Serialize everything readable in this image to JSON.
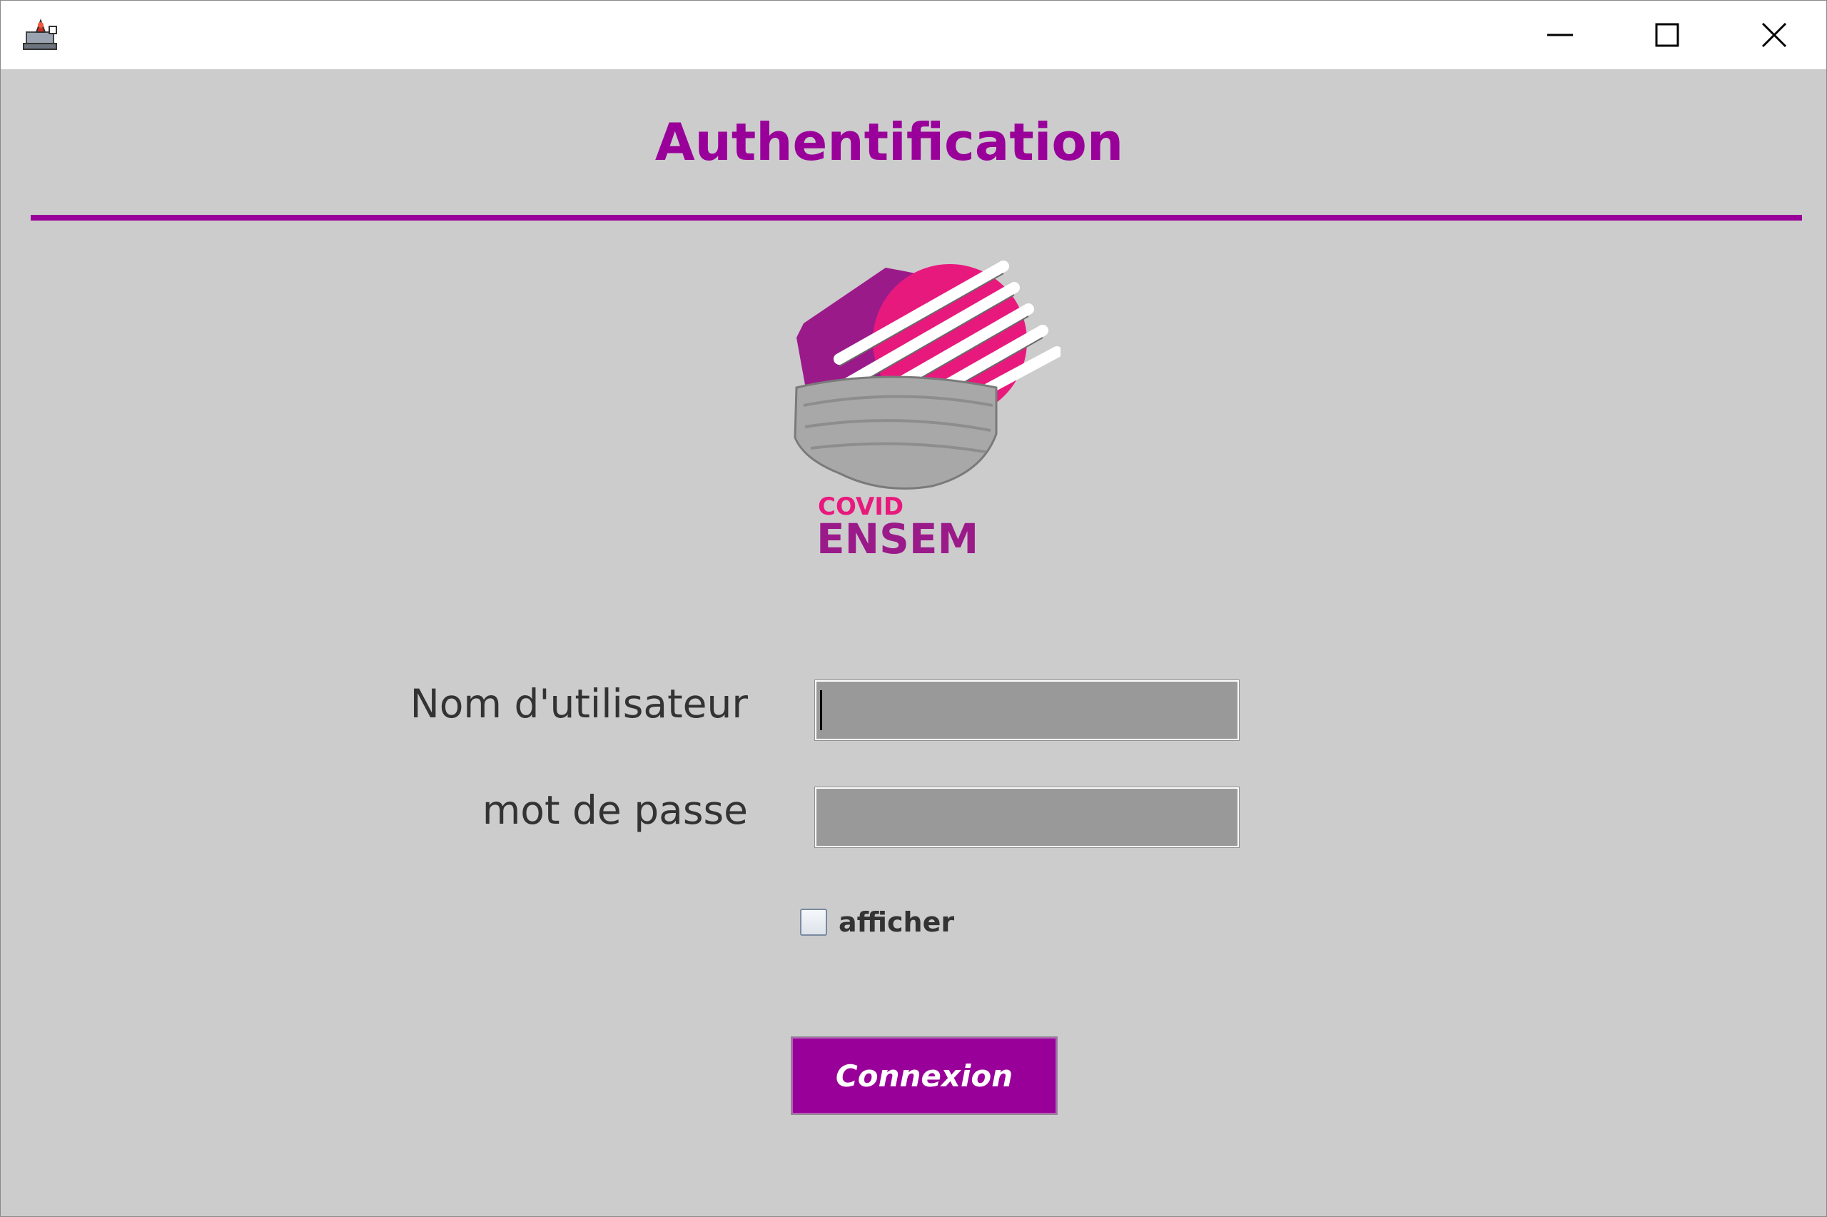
{
  "window": {
    "title": "",
    "icon": "java-app-icon",
    "controls": [
      "minimize-icon",
      "maximize-icon",
      "close-icon"
    ]
  },
  "form": {
    "heading": "Authentification",
    "logo": {
      "line1": "COVID",
      "line2": "ENSEM"
    },
    "username": {
      "label": "Nom d'utilisateur",
      "value": ""
    },
    "password": {
      "label": "mot de passe",
      "value": ""
    },
    "show_password": {
      "label": "afficher",
      "checked": false
    },
    "submit_label": "Connexion"
  },
  "colors": {
    "accent": "#990099",
    "background": "#cccccc",
    "field": "#999999",
    "logo_pink": "#e8197d",
    "logo_purple": "#9b1a8a"
  }
}
